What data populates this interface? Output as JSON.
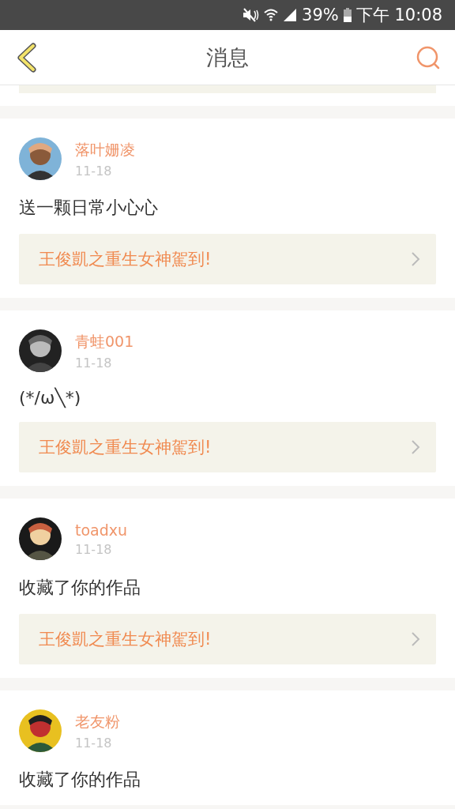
{
  "status_bar": {
    "battery": "39%",
    "time": "下午 10:08"
  },
  "header": {
    "title": "消息"
  },
  "messages": [
    {
      "name": "落叶姗凌",
      "date": "11-18",
      "text": "送一颗日常小心心",
      "link": "王俊凱之重生女神駕到!"
    },
    {
      "name": "青蛙001",
      "date": "11-18",
      "text": "(*/ω╲*)",
      "link": "王俊凱之重生女神駕到!"
    },
    {
      "name": "toadxu",
      "date": "11-18",
      "text": "收藏了你的作品",
      "link": "王俊凱之重生女神駕到!"
    },
    {
      "name": "老友粉",
      "date": "11-18",
      "text": "收藏了你的作品"
    }
  ]
}
